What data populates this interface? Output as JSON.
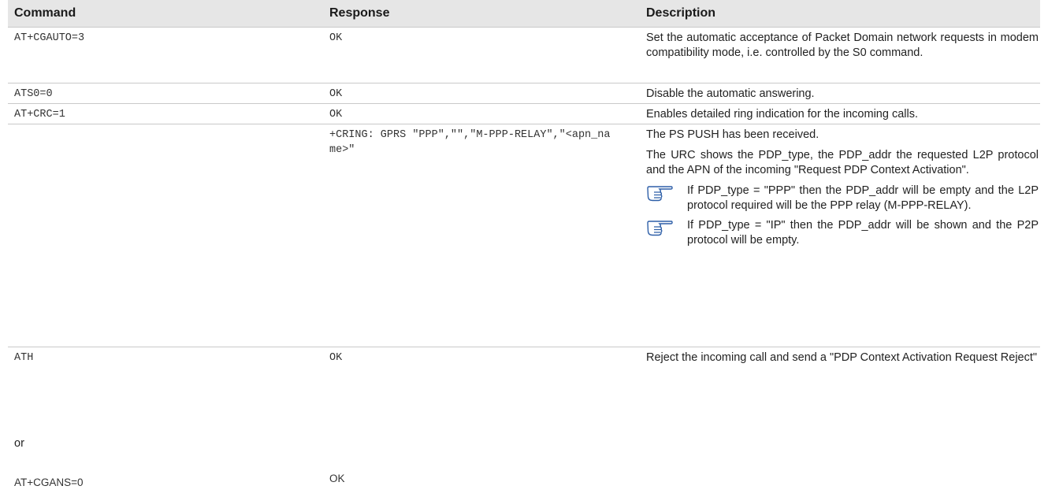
{
  "headers": [
    "Command",
    "Response",
    "Description"
  ],
  "rows": [
    {
      "command": "AT+CGAUTO=3",
      "response": "OK",
      "description": "Set the automatic acceptance of Packet Domain network requests in modem compatibility mode, i.e. controlled by the S0 command."
    },
    {
      "command": "ATS0=0",
      "response": "OK",
      "description": "Disable the automatic answering."
    },
    {
      "command": "AT+CRC=1",
      "response": "OK",
      "description": "Enables detailed ring indication for the incoming calls."
    },
    {
      "command": "",
      "response": "+CRING: GPRS \"PPP\",\"\",\"M-PPP-RELAY\",\"<apn_name>\"",
      "description_p1": "The PS PUSH has been received.",
      "description_p2": "The URC shows the PDP_type, the PDP_addr the requested L2P protocol and the APN of the incoming \"Request PDP Context Activation\".",
      "notes": [
        {
          "icon": "pointing-hand-icon",
          "text": "If PDP_type = \"PPP\" then the PDP_addr will be empty and the L2P protocol required will be the PPP relay (M-PPP-RELAY)."
        },
        {
          "icon": "pointing-hand-icon",
          "text": "If PDP_type = \"IP\" then the PDP_addr will be shown and the P2P protocol will be empty."
        }
      ]
    },
    {
      "command": "ATH",
      "response": "OK",
      "description": "Reject the incoming call and send a \"PDP Context Activation Request Reject\""
    }
  ],
  "or_label": "or",
  "last_row": {
    "command": "AT+CGANS=0",
    "response": "OK"
  }
}
